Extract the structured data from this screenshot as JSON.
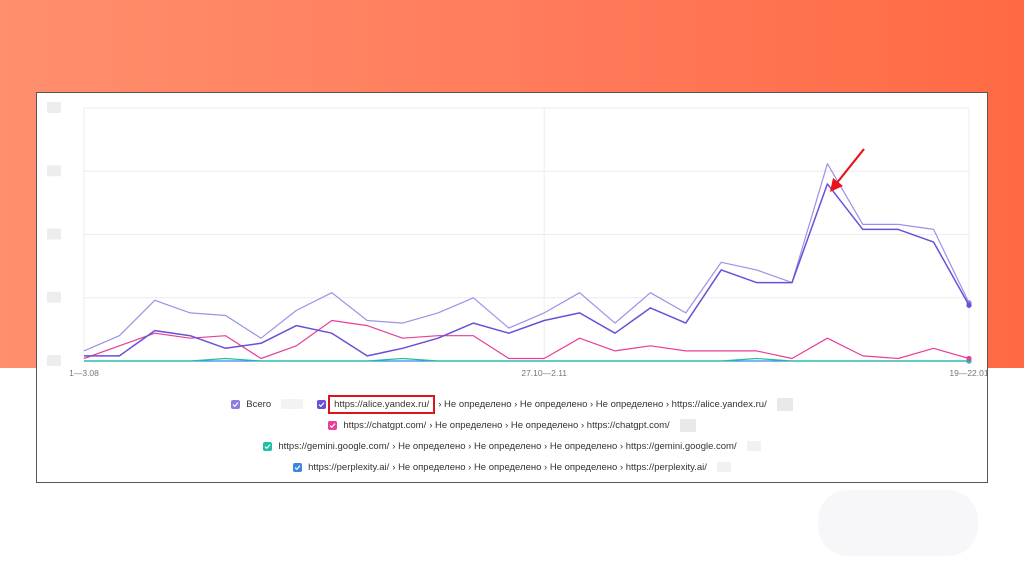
{
  "colors": {
    "banner_left": "#ff8f6d",
    "banner_right": "#ff6a44",
    "highlight_box": "#d9161c",
    "annotation_arrow": "#e8141a"
  },
  "chart_data": {
    "type": "line",
    "x_tick_labels": [
      "1—3.08",
      "27.10—2.11",
      "19—22.01"
    ],
    "grid": true,
    "y_tick_labels_blurred": true,
    "legend_position": "bottom",
    "ylim": [
      0,
      100
    ],
    "n_points": 34,
    "series": [
      {
        "name": "Всего",
        "color": "#8a7fe0",
        "values": [
          4,
          10,
          24,
          19,
          18,
          9,
          20,
          27,
          16,
          15,
          19,
          25,
          13,
          19,
          27,
          15,
          27,
          19,
          39,
          36,
          31,
          78,
          54,
          54,
          52,
          23
        ]
      },
      {
        "name": "https://alice.yandex.ru/",
        "color": "#6a4fd8",
        "values": [
          2,
          2,
          12,
          10,
          5,
          7,
          14,
          11,
          2,
          5,
          9,
          15,
          11,
          16,
          19,
          11,
          21,
          15,
          36,
          31,
          31,
          70,
          52,
          52,
          47,
          22
        ]
      },
      {
        "name": "https://chatgpt.com/",
        "color": "#e83e9a",
        "values": [
          1,
          6,
          11,
          9,
          10,
          1,
          6,
          16,
          14,
          9,
          10,
          10,
          1,
          1,
          9,
          4,
          6,
          4,
          4,
          4,
          1,
          9,
          2,
          1,
          5,
          1
        ]
      },
      {
        "name": "https://gemini.google.com/",
        "color": "#1fbfa6",
        "values": [
          0,
          0,
          0,
          0,
          1,
          0,
          0,
          0,
          0,
          1,
          0,
          0,
          0,
          0,
          0,
          0,
          0,
          0,
          0,
          1,
          0,
          0,
          0,
          0,
          0,
          0
        ]
      },
      {
        "name": "https://perplexity.ai/",
        "color": "#3a86e0",
        "values": [
          0,
          0,
          0,
          0,
          0,
          0,
          0,
          0,
          0,
          0,
          0,
          0,
          0,
          0,
          0,
          0,
          0,
          0,
          0,
          0,
          0,
          0,
          0,
          0,
          0,
          0
        ]
      }
    ]
  },
  "legend": {
    "total": {
      "label": "Всего",
      "color": "#8a7fe0"
    },
    "items": [
      {
        "url": "https://alice.yandex.ru/",
        "path": "› Не определено › Не определено › Не определено › https://alice.yandex.ru/",
        "color": "#6a4fd8"
      },
      {
        "url": "https://chatgpt.com/",
        "path": "› Не определено › Не определено › https://chatgpt.com/",
        "color": "#e83e9a"
      },
      {
        "url": "https://gemini.google.com/",
        "path": "› Не определено › Не определено › Не определено › https://gemini.google.com/",
        "color": "#1fbfa6"
      },
      {
        "url": "https://perplexity.ai/",
        "path": "› Не определено › Не определено › Не определено › https://perplexity.ai/",
        "color": "#3a86e0"
      }
    ]
  }
}
